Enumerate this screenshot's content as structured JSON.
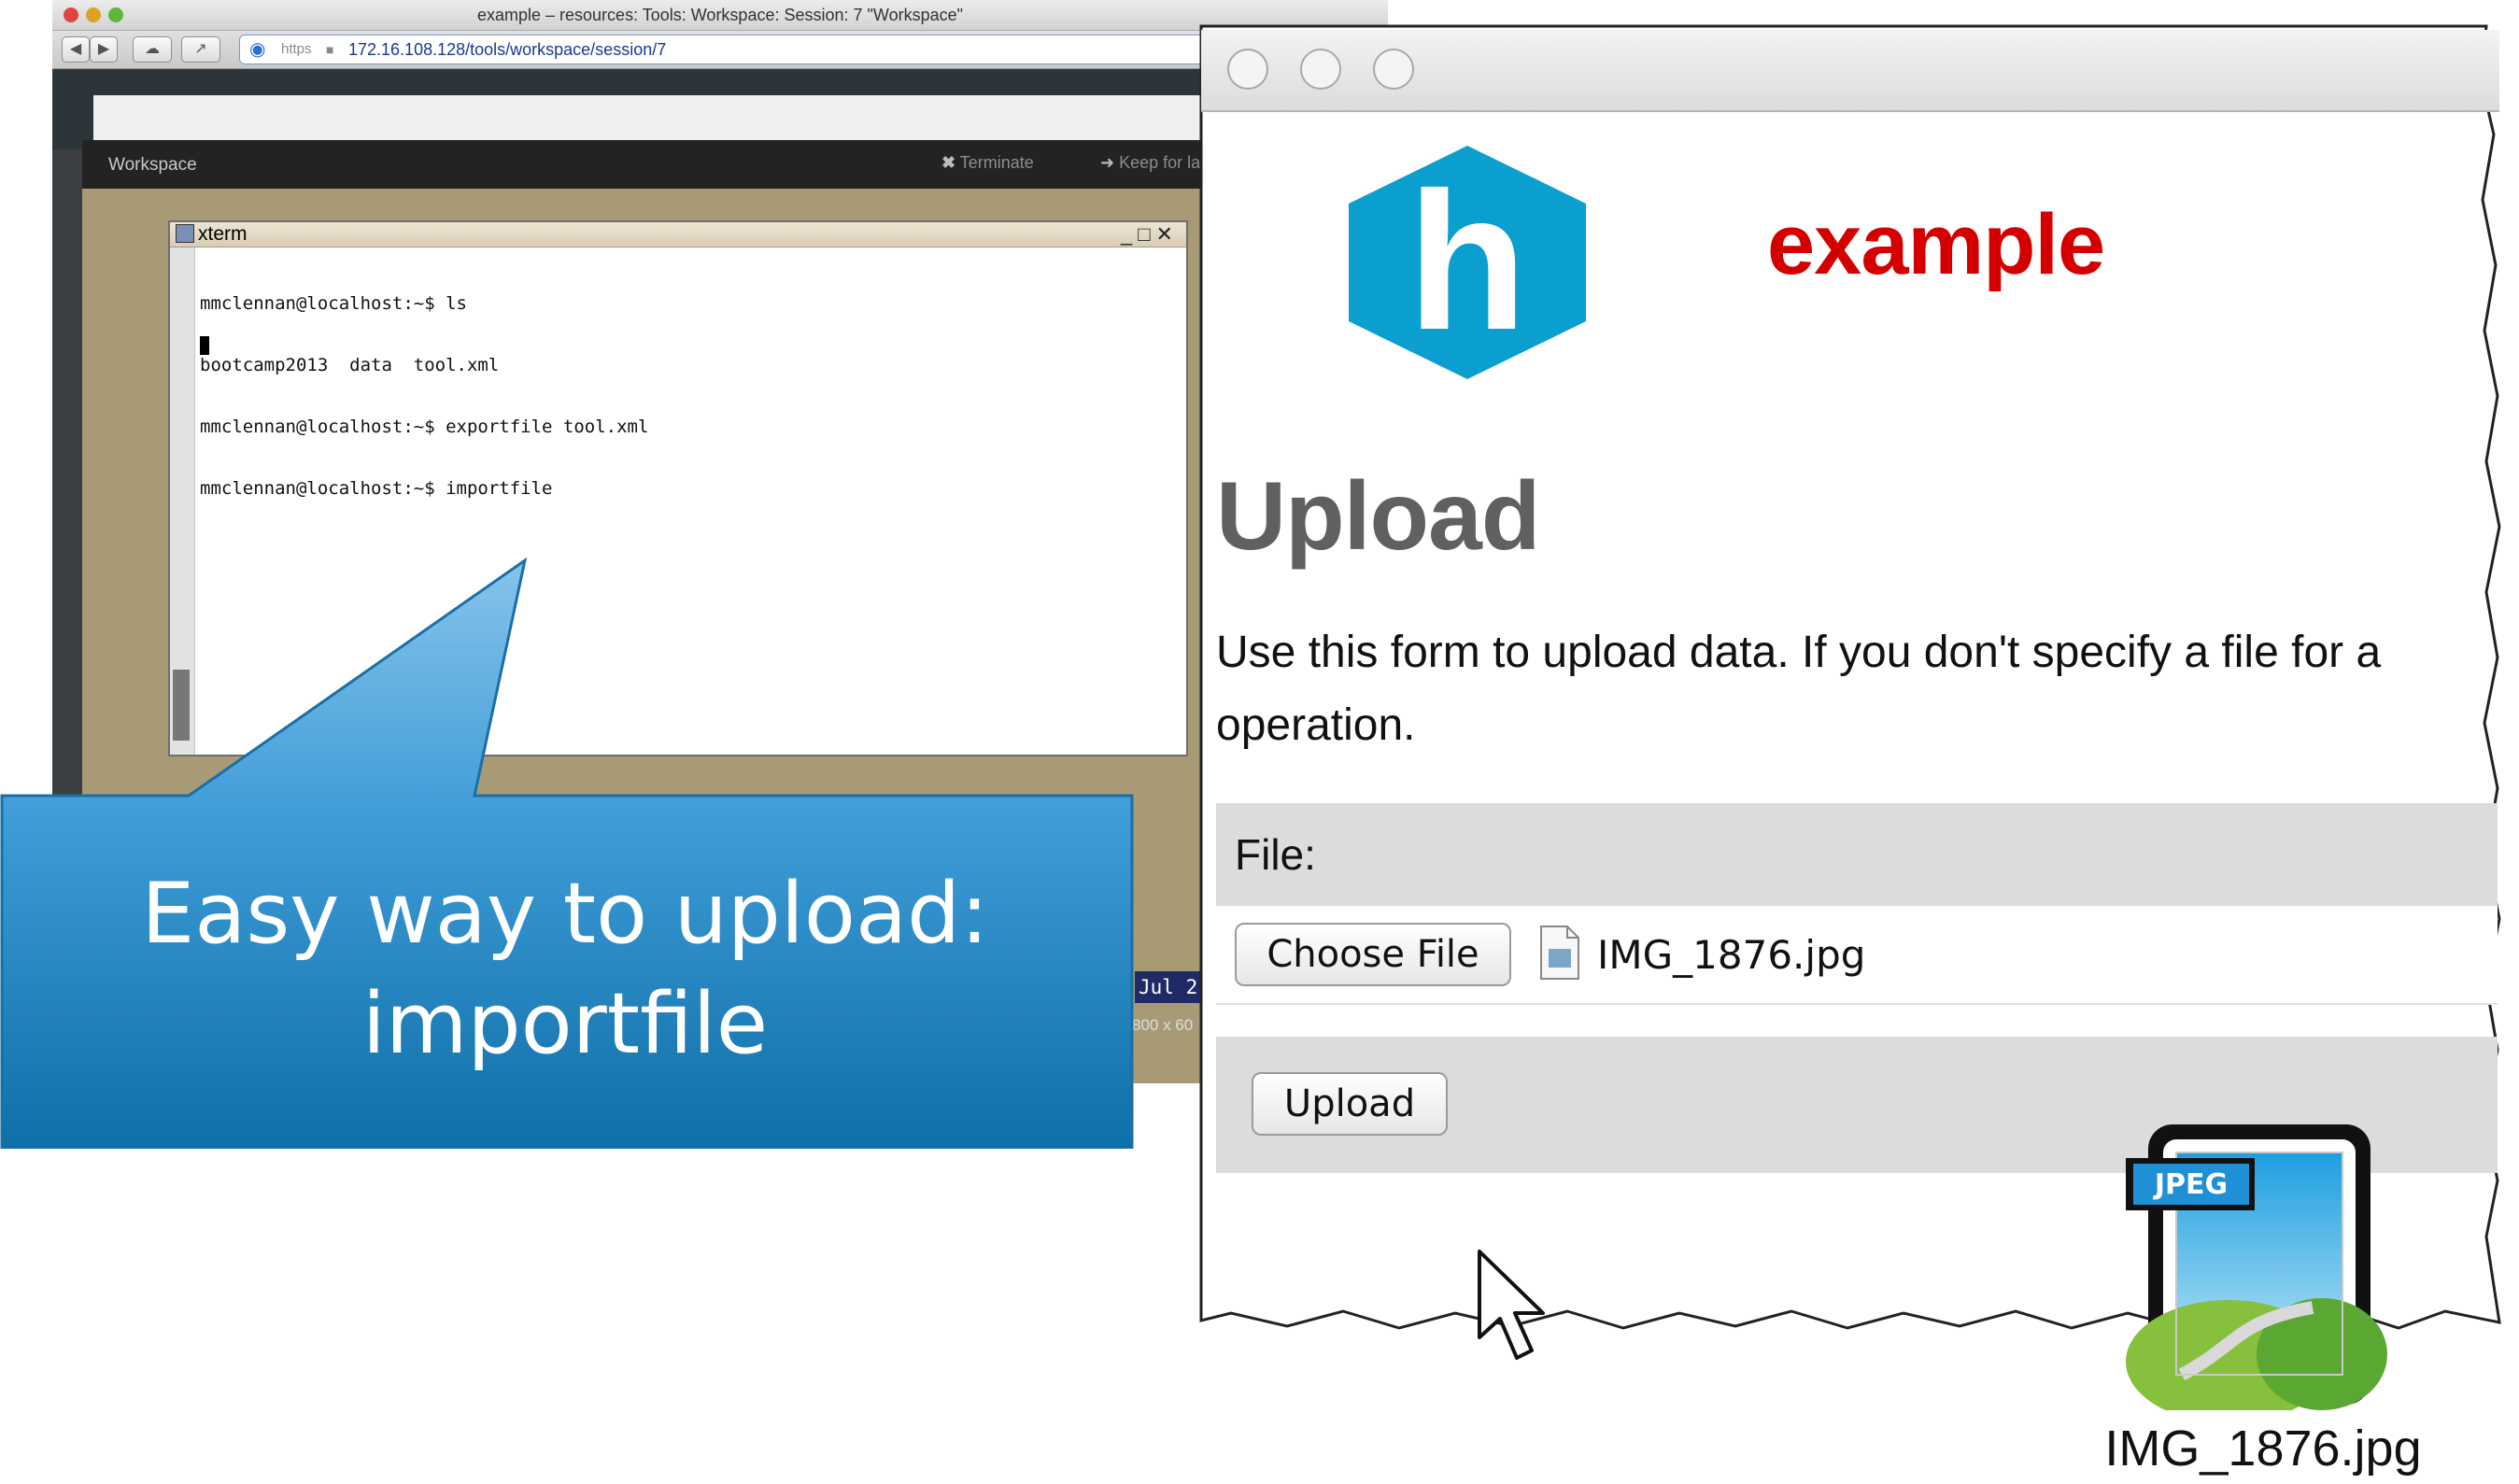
{
  "browser": {
    "title": "example – resources: Tools: Workspace: Session: 7 \"Workspace\"",
    "url_scheme": "https",
    "url": "172.16.108.128/tools/workspace/session/7"
  },
  "workspace": {
    "title": "Workspace",
    "terminate_label": "Terminate",
    "keep_label": "Keep for lat"
  },
  "xterm": {
    "title": "xterm",
    "controls": "_□✕",
    "lines": [
      "mmclennan@localhost:~$ ls",
      "bootcamp2013  data  tool.xml",
      "mmclennan@localhost:~$ exportfile tool.xml",
      "mmclennan@localhost:~$ importfile"
    ]
  },
  "status_bar": {
    "date": "Jul 2",
    "resolution": "800 x 60"
  },
  "callout": {
    "line1": "Easy way to upload:",
    "line2": "importfile"
  },
  "upload_page": {
    "site_name": "example",
    "logo_letter": "h",
    "heading": "Upload",
    "description_line1": "Use this form to upload data. If you don't specify a file for a",
    "description_line2": "operation.",
    "file_label": "File:",
    "choose_button": "Choose File",
    "selected_file": "IMG_1876.jpg",
    "upload_button": "Upload"
  },
  "dragged_file": {
    "badge": "JPEG",
    "name": "IMG_1876.jpg"
  },
  "colors": {
    "logo_blue": "#0a9fcf",
    "site_name_red": "#d40000",
    "callout_blue_top": "#86c4ec",
    "callout_blue_bottom": "#0f6fa8"
  }
}
